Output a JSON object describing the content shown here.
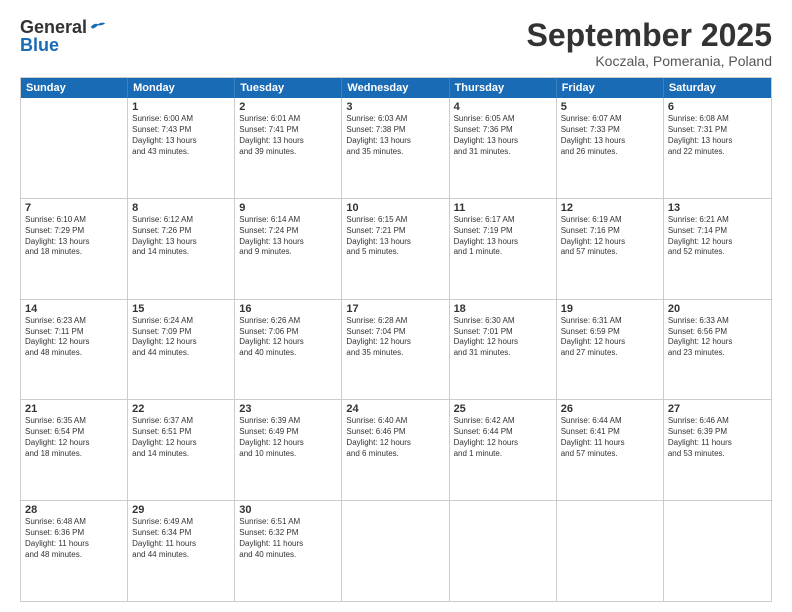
{
  "logo": {
    "general": "General",
    "blue": "Blue"
  },
  "header": {
    "month": "September 2025",
    "location": "Koczala, Pomerania, Poland"
  },
  "weekdays": [
    "Sunday",
    "Monday",
    "Tuesday",
    "Wednesday",
    "Thursday",
    "Friday",
    "Saturday"
  ],
  "rows": [
    [
      {
        "day": "",
        "info": ""
      },
      {
        "day": "1",
        "info": "Sunrise: 6:00 AM\nSunset: 7:43 PM\nDaylight: 13 hours\nand 43 minutes."
      },
      {
        "day": "2",
        "info": "Sunrise: 6:01 AM\nSunset: 7:41 PM\nDaylight: 13 hours\nand 39 minutes."
      },
      {
        "day": "3",
        "info": "Sunrise: 6:03 AM\nSunset: 7:38 PM\nDaylight: 13 hours\nand 35 minutes."
      },
      {
        "day": "4",
        "info": "Sunrise: 6:05 AM\nSunset: 7:36 PM\nDaylight: 13 hours\nand 31 minutes."
      },
      {
        "day": "5",
        "info": "Sunrise: 6:07 AM\nSunset: 7:33 PM\nDaylight: 13 hours\nand 26 minutes."
      },
      {
        "day": "6",
        "info": "Sunrise: 6:08 AM\nSunset: 7:31 PM\nDaylight: 13 hours\nand 22 minutes."
      }
    ],
    [
      {
        "day": "7",
        "info": "Sunrise: 6:10 AM\nSunset: 7:29 PM\nDaylight: 13 hours\nand 18 minutes."
      },
      {
        "day": "8",
        "info": "Sunrise: 6:12 AM\nSunset: 7:26 PM\nDaylight: 13 hours\nand 14 minutes."
      },
      {
        "day": "9",
        "info": "Sunrise: 6:14 AM\nSunset: 7:24 PM\nDaylight: 13 hours\nand 9 minutes."
      },
      {
        "day": "10",
        "info": "Sunrise: 6:15 AM\nSunset: 7:21 PM\nDaylight: 13 hours\nand 5 minutes."
      },
      {
        "day": "11",
        "info": "Sunrise: 6:17 AM\nSunset: 7:19 PM\nDaylight: 13 hours\nand 1 minute."
      },
      {
        "day": "12",
        "info": "Sunrise: 6:19 AM\nSunset: 7:16 PM\nDaylight: 12 hours\nand 57 minutes."
      },
      {
        "day": "13",
        "info": "Sunrise: 6:21 AM\nSunset: 7:14 PM\nDaylight: 12 hours\nand 52 minutes."
      }
    ],
    [
      {
        "day": "14",
        "info": "Sunrise: 6:23 AM\nSunset: 7:11 PM\nDaylight: 12 hours\nand 48 minutes."
      },
      {
        "day": "15",
        "info": "Sunrise: 6:24 AM\nSunset: 7:09 PM\nDaylight: 12 hours\nand 44 minutes."
      },
      {
        "day": "16",
        "info": "Sunrise: 6:26 AM\nSunset: 7:06 PM\nDaylight: 12 hours\nand 40 minutes."
      },
      {
        "day": "17",
        "info": "Sunrise: 6:28 AM\nSunset: 7:04 PM\nDaylight: 12 hours\nand 35 minutes."
      },
      {
        "day": "18",
        "info": "Sunrise: 6:30 AM\nSunset: 7:01 PM\nDaylight: 12 hours\nand 31 minutes."
      },
      {
        "day": "19",
        "info": "Sunrise: 6:31 AM\nSunset: 6:59 PM\nDaylight: 12 hours\nand 27 minutes."
      },
      {
        "day": "20",
        "info": "Sunrise: 6:33 AM\nSunset: 6:56 PM\nDaylight: 12 hours\nand 23 minutes."
      }
    ],
    [
      {
        "day": "21",
        "info": "Sunrise: 6:35 AM\nSunset: 6:54 PM\nDaylight: 12 hours\nand 18 minutes."
      },
      {
        "day": "22",
        "info": "Sunrise: 6:37 AM\nSunset: 6:51 PM\nDaylight: 12 hours\nand 14 minutes."
      },
      {
        "day": "23",
        "info": "Sunrise: 6:39 AM\nSunset: 6:49 PM\nDaylight: 12 hours\nand 10 minutes."
      },
      {
        "day": "24",
        "info": "Sunrise: 6:40 AM\nSunset: 6:46 PM\nDaylight: 12 hours\nand 6 minutes."
      },
      {
        "day": "25",
        "info": "Sunrise: 6:42 AM\nSunset: 6:44 PM\nDaylight: 12 hours\nand 1 minute."
      },
      {
        "day": "26",
        "info": "Sunrise: 6:44 AM\nSunset: 6:41 PM\nDaylight: 11 hours\nand 57 minutes."
      },
      {
        "day": "27",
        "info": "Sunrise: 6:46 AM\nSunset: 6:39 PM\nDaylight: 11 hours\nand 53 minutes."
      }
    ],
    [
      {
        "day": "28",
        "info": "Sunrise: 6:48 AM\nSunset: 6:36 PM\nDaylight: 11 hours\nand 48 minutes."
      },
      {
        "day": "29",
        "info": "Sunrise: 6:49 AM\nSunset: 6:34 PM\nDaylight: 11 hours\nand 44 minutes."
      },
      {
        "day": "30",
        "info": "Sunrise: 6:51 AM\nSunset: 6:32 PM\nDaylight: 11 hours\nand 40 minutes."
      },
      {
        "day": "",
        "info": ""
      },
      {
        "day": "",
        "info": ""
      },
      {
        "day": "",
        "info": ""
      },
      {
        "day": "",
        "info": ""
      }
    ]
  ]
}
